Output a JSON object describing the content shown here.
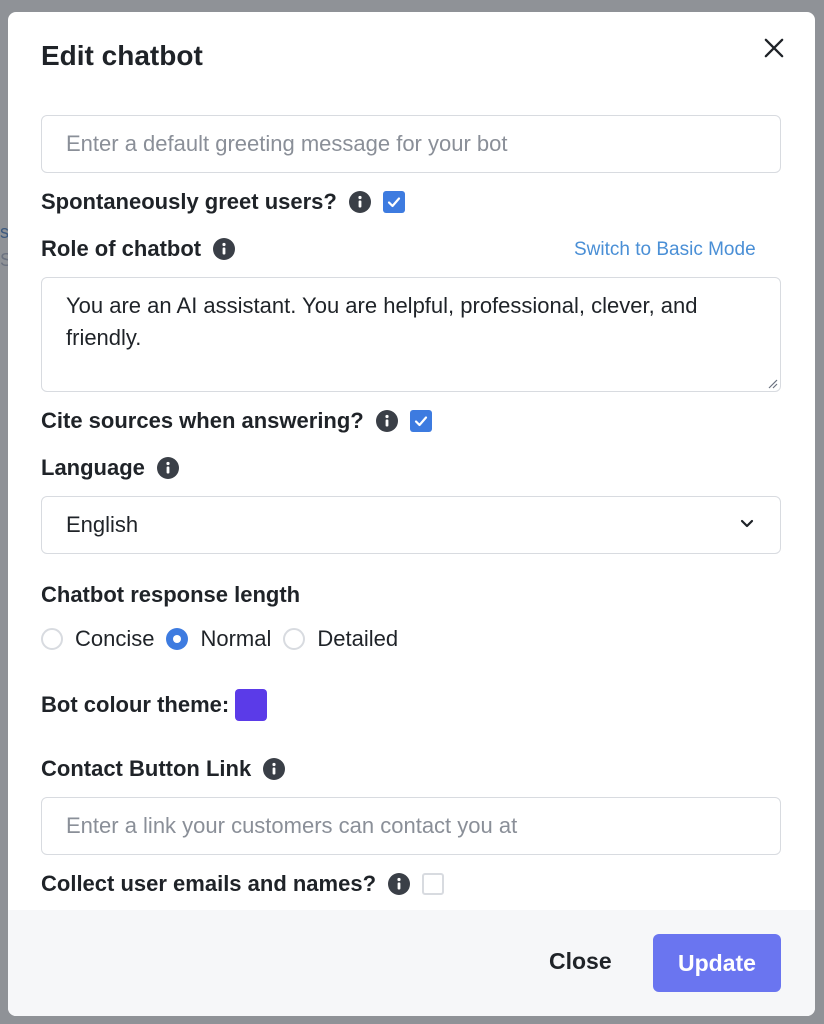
{
  "backdrop": {
    "fragment_1": "s",
    "fragment_2": "S"
  },
  "modal": {
    "title": "Edit chatbot",
    "greeting": {
      "placeholder": "Enter a default greeting message for your bot",
      "value": ""
    },
    "spontaneous_greet": {
      "label": "Spontaneously greet users?",
      "checked": true
    },
    "role": {
      "label": "Role of chatbot",
      "switch_mode_link": "Switch to Basic Mode",
      "value": "You are an AI assistant. You are helpful, professional, clever, and friendly."
    },
    "cite_sources": {
      "label": "Cite sources when answering?",
      "checked": true
    },
    "language": {
      "label": "Language",
      "selected": "English"
    },
    "response_length": {
      "label": "Chatbot response length",
      "options": [
        {
          "label": "Concise",
          "selected": false
        },
        {
          "label": "Normal",
          "selected": true
        },
        {
          "label": "Detailed",
          "selected": false
        }
      ]
    },
    "colour_theme": {
      "label": "Bot colour theme:",
      "color": "#5b3be8"
    },
    "contact_link": {
      "label": "Contact Button Link",
      "placeholder": "Enter a link your customers can contact you at",
      "value": ""
    },
    "collect_emails": {
      "label": "Collect user emails and names?",
      "checked": false
    },
    "footer": {
      "close_label": "Close",
      "update_label": "Update"
    }
  },
  "colors": {
    "accent": "#3d7be0",
    "primary_button": "#6a75f0",
    "link": "#4a8fd6"
  }
}
